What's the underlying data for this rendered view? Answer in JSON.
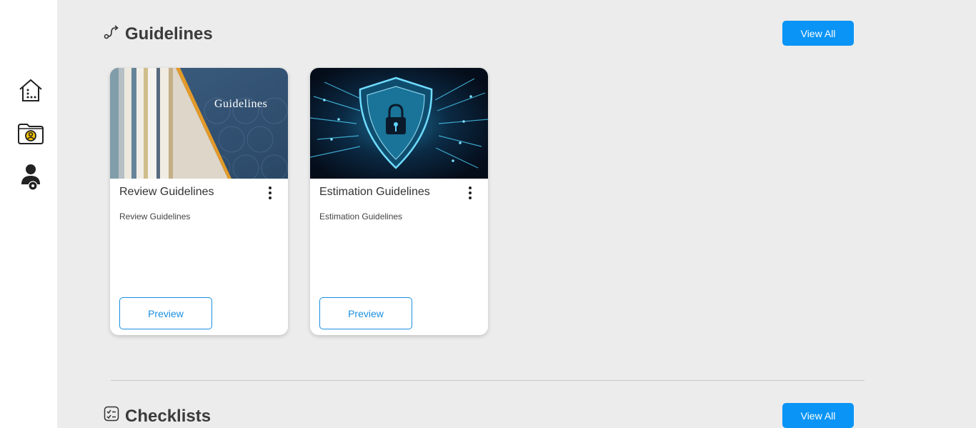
{
  "sidebar": {
    "items": [
      {
        "icon": "home-icon"
      },
      {
        "icon": "folder-user-icon"
      },
      {
        "icon": "user-settings-icon"
      }
    ]
  },
  "guidelines": {
    "title": "Guidelines",
    "icon": "route-icon",
    "view_all_label": "View All",
    "cards": [
      {
        "title": "Review Guidelines",
        "description": "Review Guidelines",
        "image_text": "Guidelines",
        "preview_label": "Preview"
      },
      {
        "title": "Estimation Guidelines",
        "description": "Estimation Guidelines",
        "preview_label": "Preview"
      }
    ]
  },
  "checklists": {
    "title": "Checklists",
    "icon": "checklist-icon",
    "view_all_label": "View All"
  },
  "colors": {
    "accent": "#0a94f5",
    "background": "#ececec",
    "sidebar": "#ffffff"
  }
}
